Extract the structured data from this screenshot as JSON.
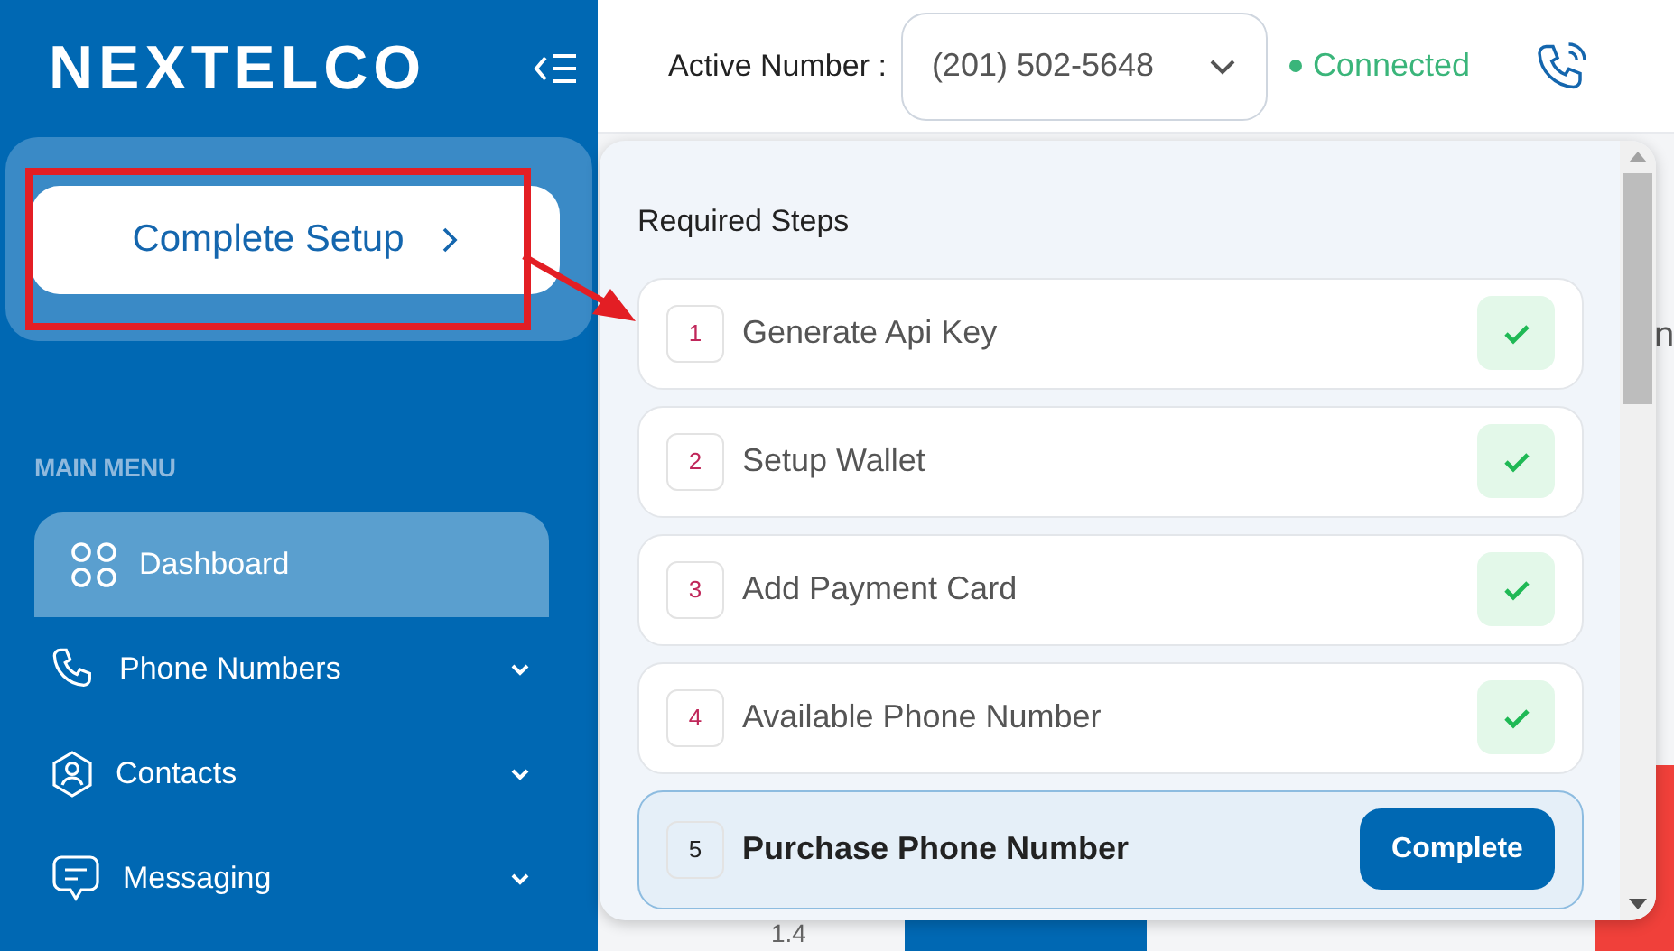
{
  "sidebar": {
    "logo": "NEXTELCO",
    "setup_button": "Complete Setup",
    "section_label": "MAIN MENU",
    "items": [
      {
        "label": "Dashboard",
        "selected": true,
        "expandable": false
      },
      {
        "label": "Phone Numbers",
        "selected": false,
        "expandable": true
      },
      {
        "label": "Contacts",
        "selected": false,
        "expandable": true
      },
      {
        "label": "Messaging",
        "selected": false,
        "expandable": true
      }
    ]
  },
  "header": {
    "active_number_label": "Active Number :",
    "active_number": "(201) 502-5648",
    "status": "Connected"
  },
  "steps_popup": {
    "title": "Required Steps",
    "steps": [
      {
        "number": "1",
        "label": "Generate Api Key",
        "completed": true
      },
      {
        "number": "2",
        "label": "Setup Wallet",
        "completed": true
      },
      {
        "number": "3",
        "label": "Add Payment Card",
        "completed": true
      },
      {
        "number": "4",
        "label": "Available Phone Number",
        "completed": true
      },
      {
        "number": "5",
        "label": "Purchase Phone Number",
        "completed": false,
        "action": "Complete"
      }
    ]
  },
  "background": {
    "heading_fragment": "n",
    "axis_tick": "1.4"
  }
}
